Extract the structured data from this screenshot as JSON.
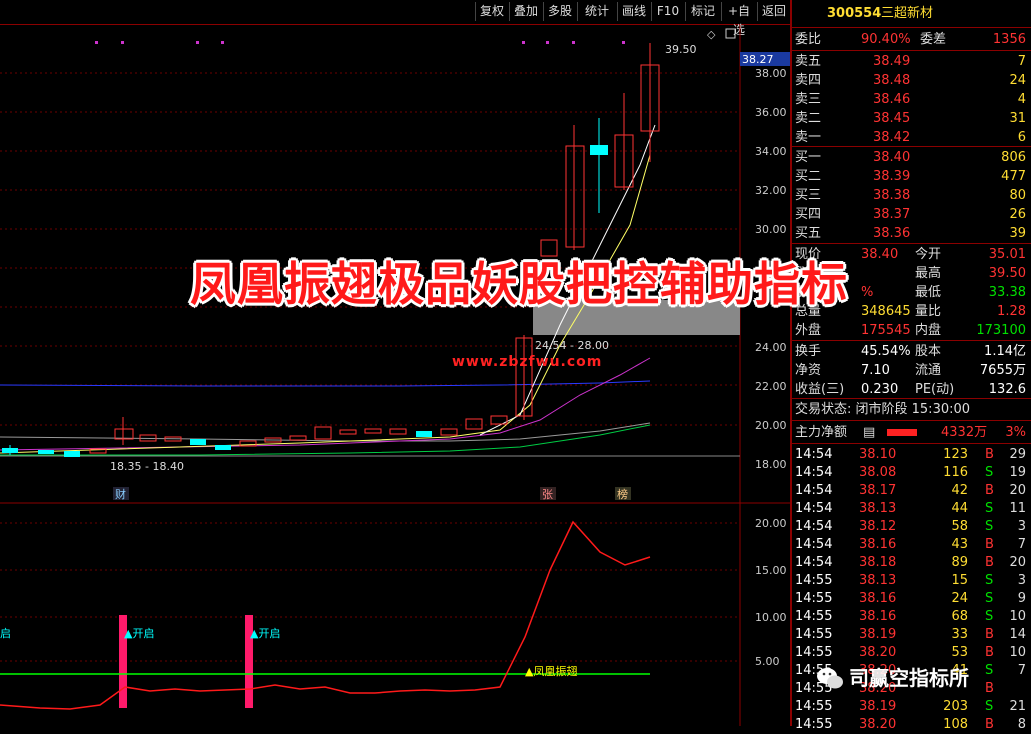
{
  "toolbar": {
    "buttons": [
      "复权",
      "叠加",
      "多股",
      "统计",
      "画线",
      "F10",
      "标记",
      "+自选",
      "返回"
    ]
  },
  "stock": {
    "code": "300554",
    "name": "三超新材"
  },
  "quote": {
    "webi_label": "委比",
    "webi_value": "90.40%",
    "weicha_label": "委差",
    "weicha_value": "1356",
    "sell": [
      {
        "label": "卖五",
        "price": "38.49",
        "vol": "7"
      },
      {
        "label": "卖四",
        "price": "38.48",
        "vol": "24"
      },
      {
        "label": "卖三",
        "price": "38.46",
        "vol": "4"
      },
      {
        "label": "卖二",
        "price": "38.45",
        "vol": "31"
      },
      {
        "label": "卖一",
        "price": "38.42",
        "vol": "6"
      }
    ],
    "buy": [
      {
        "label": "买一",
        "price": "38.40",
        "vol": "806"
      },
      {
        "label": "买二",
        "price": "38.39",
        "vol": "477"
      },
      {
        "label": "买三",
        "price": "38.38",
        "vol": "80"
      },
      {
        "label": "买四",
        "price": "38.37",
        "vol": "26"
      },
      {
        "label": "买五",
        "price": "38.36",
        "vol": "39"
      }
    ],
    "stats": [
      {
        "l1": "现价",
        "v1": "38.40",
        "l2": "今开",
        "v2": "35.01"
      },
      {
        "l1": "涨跌",
        "v1": "",
        "l2": "最高",
        "v2": "39.50"
      },
      {
        "l1": "涨幅",
        "v1": "%",
        "l2": "最低",
        "v2": "33.38"
      },
      {
        "l1": "总量",
        "v1": "348645",
        "l2": "量比",
        "v2": "1.28"
      },
      {
        "l1": "外盘",
        "v1": "175545",
        "l2": "内盘",
        "v2": "173100"
      }
    ],
    "info": [
      {
        "l1": "换手",
        "v1": "45.54%",
        "l2": "股本",
        "v2": "1.14亿"
      },
      {
        "l1": "净资",
        "v1": "7.10",
        "l2": "流通",
        "v2": "7655万"
      },
      {
        "l1": "收益(三)",
        "v1": "0.230",
        "l2": "PE(动)",
        "v2": "132.6"
      }
    ],
    "trade_status": "交易状态: 闭市阶段 15:30:00",
    "main_net_label": "主力净额",
    "main_net_value": "4332万",
    "main_net_pct": "3%"
  },
  "ticks": [
    {
      "time": "14:54",
      "price": "38.10",
      "vol": "123",
      "side": "B",
      "extra": "29"
    },
    {
      "time": "14:54",
      "price": "38.08",
      "vol": "116",
      "side": "S",
      "extra": "19"
    },
    {
      "time": "14:54",
      "price": "38.17",
      "vol": "42",
      "side": "B",
      "extra": "20"
    },
    {
      "time": "14:54",
      "price": "38.13",
      "vol": "44",
      "side": "S",
      "extra": "11"
    },
    {
      "time": "14:54",
      "price": "38.12",
      "vol": "58",
      "side": "S",
      "extra": "3"
    },
    {
      "time": "14:54",
      "price": "38.16",
      "vol": "43",
      "side": "B",
      "extra": "7"
    },
    {
      "time": "14:54",
      "price": "38.18",
      "vol": "89",
      "side": "B",
      "extra": "20"
    },
    {
      "time": "14:55",
      "price": "38.13",
      "vol": "15",
      "side": "S",
      "extra": "3"
    },
    {
      "time": "14:55",
      "price": "38.16",
      "vol": "24",
      "side": "S",
      "extra": "9"
    },
    {
      "time": "14:55",
      "price": "38.16",
      "vol": "68",
      "side": "S",
      "extra": "10"
    },
    {
      "time": "14:55",
      "price": "38.19",
      "vol": "33",
      "side": "B",
      "extra": "14"
    },
    {
      "time": "14:55",
      "price": "38.20",
      "vol": "53",
      "side": "B",
      "extra": "10"
    },
    {
      "time": "14:55",
      "price": "38.20",
      "vol": "41",
      "side": "S",
      "extra": "7"
    },
    {
      "time": "14:55",
      "price": "38.20",
      "vol": "",
      "side": "B",
      "extra": ""
    },
    {
      "time": "14:55",
      "price": "38.19",
      "vol": "203",
      "side": "S",
      "extra": "21"
    },
    {
      "time": "14:55",
      "price": "38.20",
      "vol": "108",
      "side": "B",
      "extra": "8"
    }
  ],
  "chart": {
    "price_axis": [
      "38.00",
      "36.00",
      "34.00",
      "32.00",
      "30.00",
      "24.00",
      "22.00",
      "20.00",
      "18.00"
    ],
    "current_price_tag": "38.27",
    "high_label": "39.50",
    "low_label": "18.35 - 18.40",
    "range_label": "24.54 - 28.00",
    "markers": [
      "财",
      "张",
      "榜"
    ],
    "indicator_axis": [
      "20.00",
      "15.00",
      "10.00",
      "5.00"
    ],
    "signal_labels": [
      "启",
      "▲开启",
      "▲开启",
      "▲凤凰振翅"
    ]
  },
  "overlay": {
    "title": "凤凰振翅极品妖股把控辅助指标",
    "url": "www.zbzfwu.com",
    "wechat": "司赢空指标所"
  },
  "colors": {
    "up": "#ff3333",
    "down": "#00ffff",
    "accent": "#ff1a1a"
  }
}
